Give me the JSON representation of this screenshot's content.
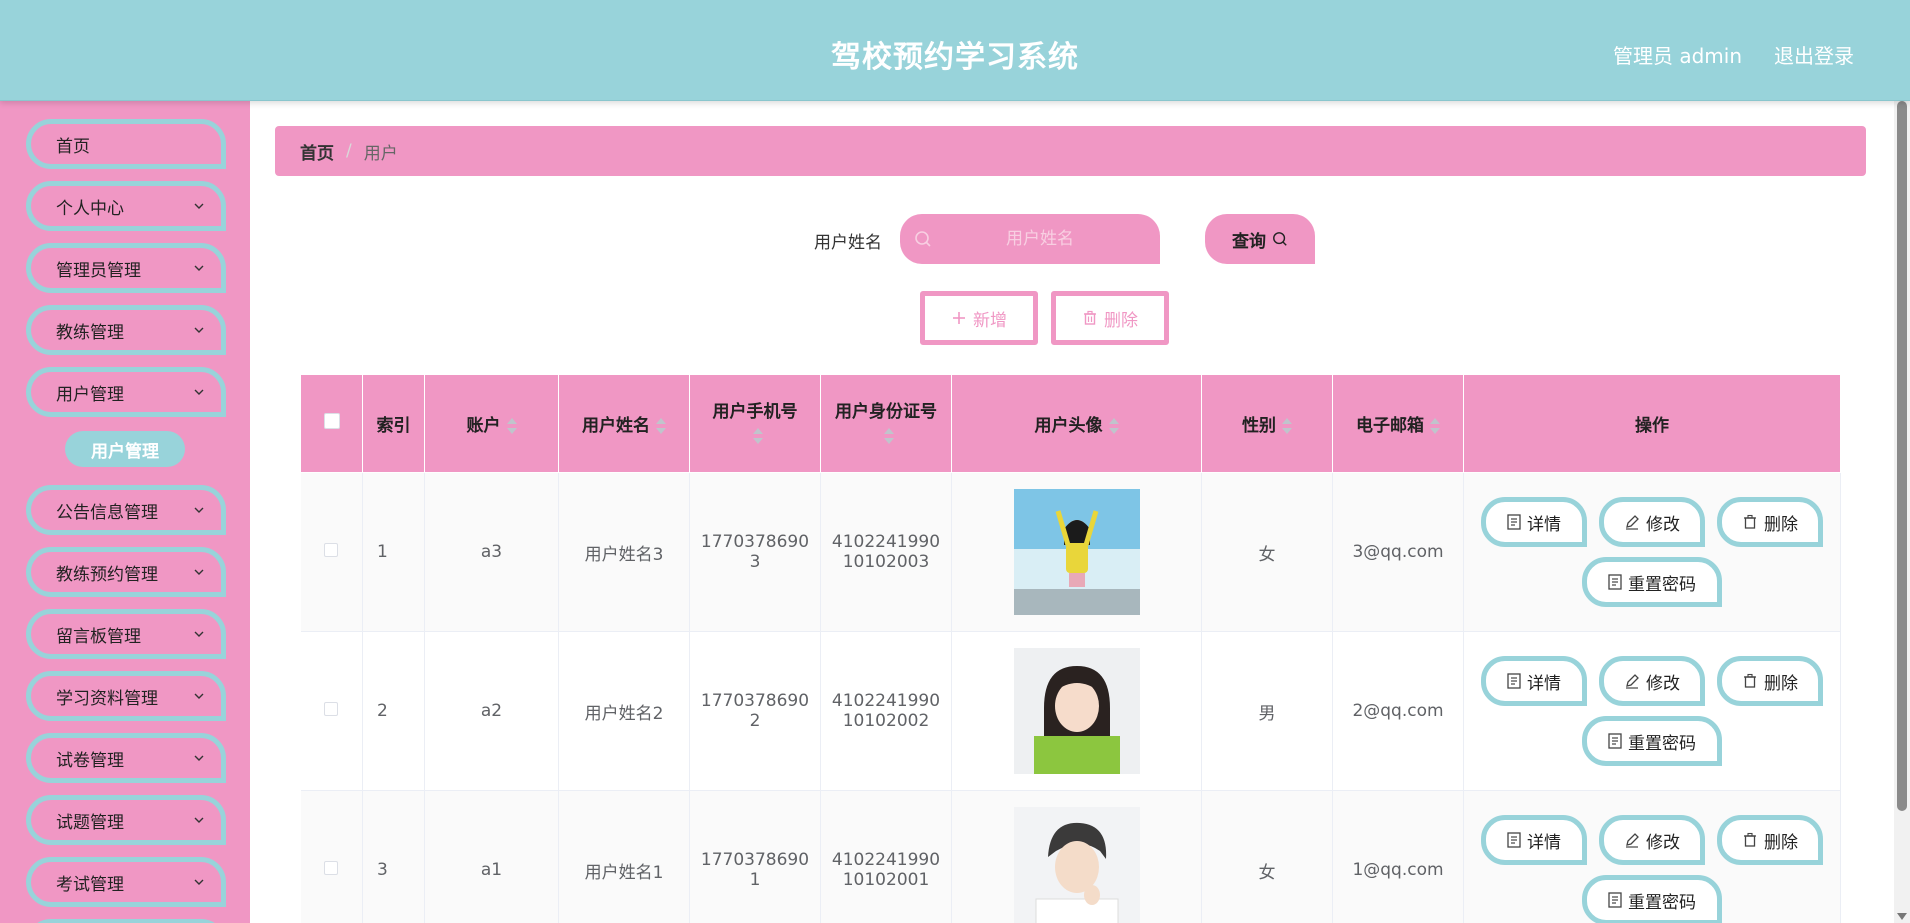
{
  "header": {
    "title": "驾校预约学习系统",
    "user": "管理员 admin",
    "logout": "退出登录"
  },
  "sidebar": {
    "items": [
      {
        "label": "首页"
      },
      {
        "label": "个人中心"
      },
      {
        "label": "管理员管理"
      },
      {
        "label": "教练管理"
      },
      {
        "label": "用户管理"
      },
      {
        "label": "公告信息管理"
      },
      {
        "label": "教练预约管理"
      },
      {
        "label": "留言板管理"
      },
      {
        "label": "学习资料管理"
      },
      {
        "label": "试卷管理"
      },
      {
        "label": "试题管理"
      },
      {
        "label": "考试管理"
      }
    ],
    "active_sub": "用户管理"
  },
  "breadcrumb": {
    "home": "首页",
    "sep": "/",
    "current": "用户"
  },
  "search": {
    "label": "用户姓名",
    "placeholder": "用户姓名",
    "button": "查询"
  },
  "actions": {
    "add": "新增",
    "delete": "删除"
  },
  "table": {
    "headers": {
      "index": "索引",
      "account": "账户",
      "name": "用户姓名",
      "phone": "用户手机号",
      "idcard": "用户身份证号",
      "avatar": "用户头像",
      "gender": "性别",
      "email": "电子邮箱",
      "ops": "操作"
    },
    "rows": [
      {
        "index": "1",
        "account": "a3",
        "name": "用户姓名3",
        "phone1": "1770378690",
        "phone2": "3",
        "id1": "4102241990",
        "id2": "10102003",
        "gender": "女",
        "email": "3@qq.com"
      },
      {
        "index": "2",
        "account": "a2",
        "name": "用户姓名2",
        "phone1": "1770378690",
        "phone2": "2",
        "id1": "4102241990",
        "id2": "10102002",
        "gender": "男",
        "email": "2@qq.com"
      },
      {
        "index": "3",
        "account": "a1",
        "name": "用户姓名1",
        "phone1": "1770378690",
        "phone2": "1",
        "id1": "4102241990",
        "id2": "10102001",
        "gender": "女",
        "email": "1@qq.com"
      }
    ],
    "op_labels": {
      "detail": "详情",
      "edit": "修改",
      "delete": "删除",
      "reset": "重置密码"
    }
  },
  "colors": {
    "header": "#98d3da",
    "pink": "#f097c4",
    "teal": "#98d3da"
  }
}
